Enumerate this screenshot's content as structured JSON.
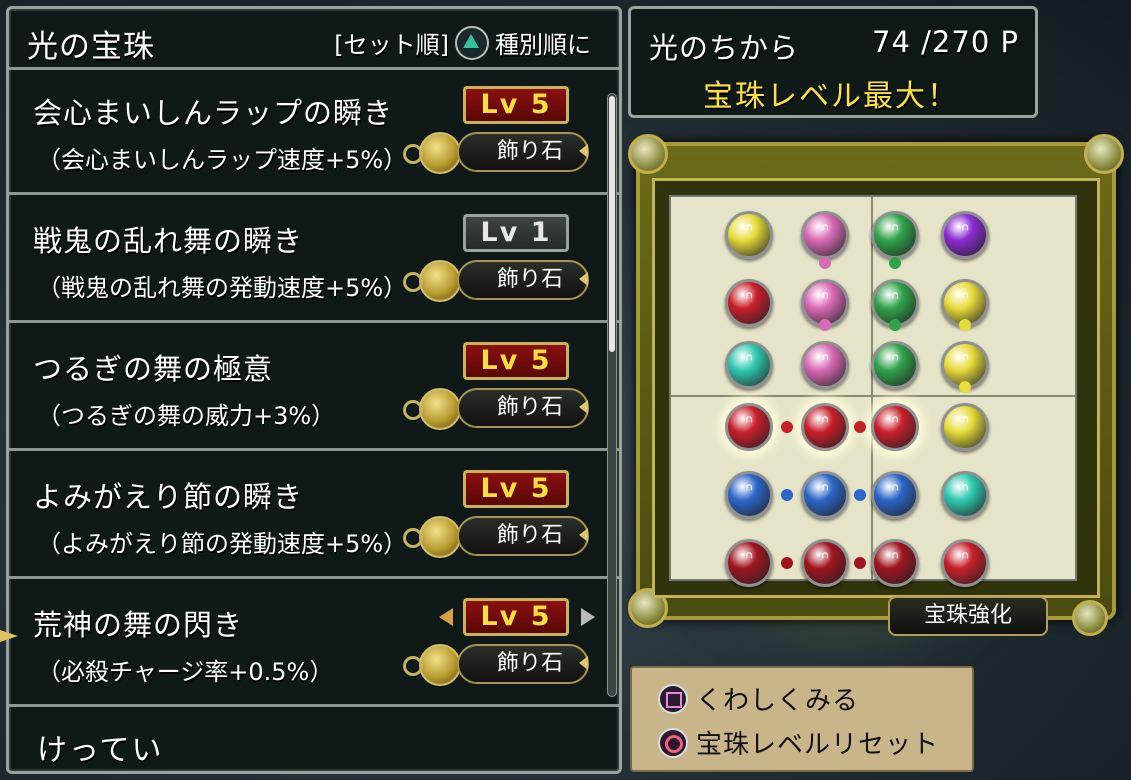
{
  "panel": {
    "title": "光の宝珠",
    "sort_label": "[セット順]",
    "sort_action": "種別順に"
  },
  "items": [
    {
      "name": "会心まいしんラップの瞬き",
      "desc": "（会心まいしんラップ速度+5%）",
      "level": "Lv 5",
      "gem": "飾り石"
    },
    {
      "name": "戦鬼の乱れ舞の瞬き",
      "desc": "（戦鬼の乱れ舞の発動速度+5%）",
      "level": "Lv 1",
      "gem": "飾り石"
    },
    {
      "name": "つるぎの舞の極意",
      "desc": "（つるぎの舞の威力+3%）",
      "level": "Lv 5",
      "gem": "飾り石"
    },
    {
      "name": "よみがえり節の瞬き",
      "desc": "（よみがえり節の発動速度+5%）",
      "level": "Lv 5",
      "gem": "飾り石"
    },
    {
      "name": "荒神の舞の閃き",
      "desc": "（必殺チャージ率+0.5%）",
      "level": "Lv 5",
      "gem": "飾り石"
    }
  ],
  "confirm": "けってい",
  "power": {
    "label": "光のちから",
    "value": "74 /270 P",
    "status": "宝珠レベル最大！"
  },
  "board": {
    "enhance_label": "宝珠強化",
    "orbs": [
      [
        "#e6dc3a",
        "#d96ab5",
        "#2fa34a",
        "#8a2bd0"
      ],
      [
        "#c81e2a",
        "#d96ab5",
        "#2fa34a",
        "#e6dc3a"
      ],
      [
        "#2ec9b0",
        "#d96ab5",
        "#2fa34a",
        "#e6dc3a"
      ],
      [
        "#c81e2a",
        "#c81e2a",
        "#c81e2a",
        "#e6dc3a"
      ],
      [
        "#2b66c8",
        "#2b66c8",
        "#2b66c8",
        "#2ec9b0"
      ],
      [
        "#a0141e",
        "#a0141e",
        "#a0141e",
        "#c81e2a"
      ]
    ]
  },
  "help": {
    "detail": "くわしくみる",
    "reset": "宝珠レベルリセット"
  },
  "colors": {
    "panel_bg": "#0f1a18",
    "level_badge": "#8b1010",
    "level_text": "#ffdf3a",
    "status_yellow": "#ffe23a"
  }
}
